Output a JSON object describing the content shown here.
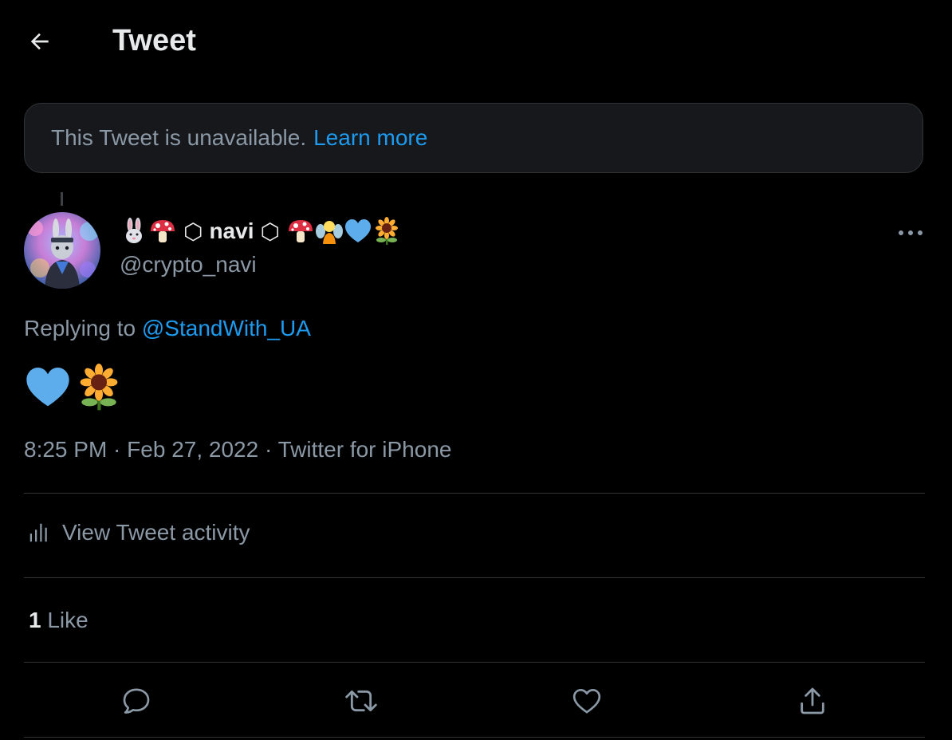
{
  "header": {
    "title": "Tweet",
    "back_icon": "arrow-left-icon"
  },
  "unavailable_notice": {
    "text": "This Tweet is unavailable.",
    "link": "Learn more"
  },
  "tweet": {
    "author": {
      "name_prefix": "⬡",
      "name": "navi",
      "name_suffix": "⬡",
      "name_emoji": [
        "rabbit-emoji",
        "mushroom-emoji",
        "mushroom-emoji",
        "fairy-emoji",
        "blue-heart-emoji",
        "sunflower-emoji"
      ],
      "handle": "@crypto_navi",
      "avatar": "nft-avatar"
    },
    "replying_to_label": "Replying to",
    "replying_to_handle": "@StandWith_UA",
    "content_emoji": [
      "blue-heart-emoji",
      "sunflower-emoji"
    ],
    "time": "8:25 PM",
    "date": "Feb 27, 2022",
    "source": "Twitter for iPhone",
    "separator": " · ",
    "activity_label": "View Tweet activity",
    "like_count": "1",
    "like_label": "Like"
  },
  "actions": [
    "reply-icon",
    "retweet-icon",
    "like-icon",
    "share-icon"
  ],
  "colors": {
    "background": "#000000",
    "link": "#1d9bf0",
    "muted": "#8b98a5",
    "text": "#e7e9ea",
    "divider": "#2f3336",
    "card": "#16181c"
  }
}
